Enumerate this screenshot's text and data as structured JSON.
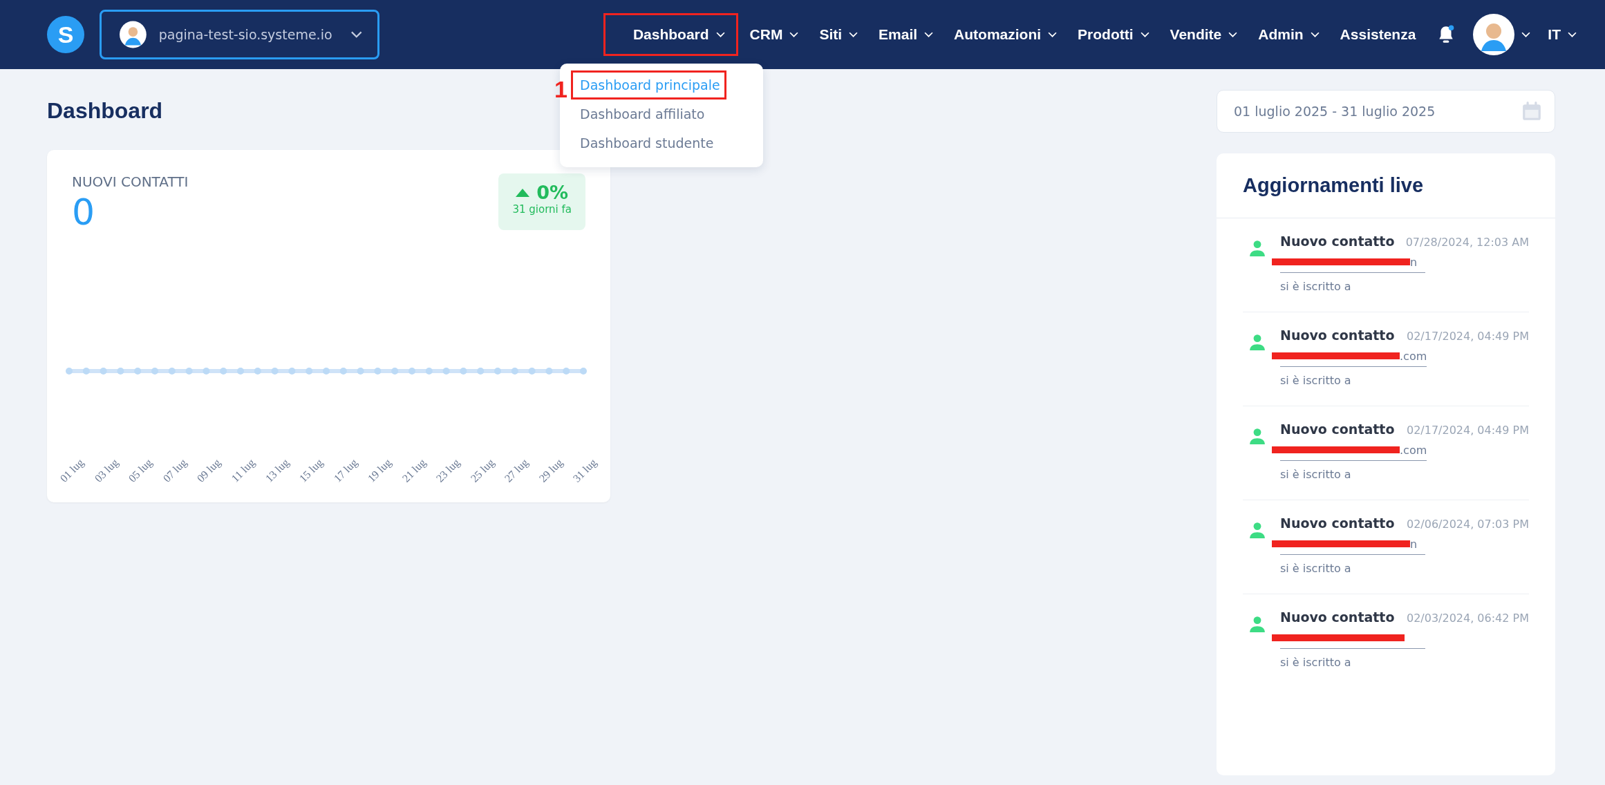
{
  "navbar": {
    "logo": "S",
    "site_selector": {
      "value": "pagina-test-sio.systeme.io"
    },
    "menu": [
      {
        "label": "Dashboard",
        "dropdown": true,
        "selected": true,
        "highlighted": true
      },
      {
        "label": "CRM",
        "dropdown": true,
        "selected": false,
        "highlighted": false
      },
      {
        "label": "Siti",
        "dropdown": true,
        "selected": false,
        "highlighted": false
      },
      {
        "label": "Email",
        "dropdown": true,
        "selected": false,
        "highlighted": false
      },
      {
        "label": "Automazioni",
        "dropdown": true,
        "selected": false,
        "highlighted": false
      },
      {
        "label": "Prodotti",
        "dropdown": true,
        "selected": false,
        "highlighted": false
      },
      {
        "label": "Vendite",
        "dropdown": true,
        "selected": false,
        "highlighted": false
      },
      {
        "label": "Admin",
        "dropdown": true,
        "selected": false,
        "highlighted": false
      },
      {
        "label": "Assistenza",
        "dropdown": false,
        "selected": false,
        "highlighted": false
      }
    ],
    "notifications": {
      "unread": true
    },
    "language": "IT"
  },
  "dropdown_menu": {
    "step_label": "1",
    "items": [
      {
        "label": "Dashboard principale",
        "selected": true,
        "highlighted": true
      },
      {
        "label": "Dashboard affiliato",
        "selected": false,
        "highlighted": false
      },
      {
        "label": "Dashboard studente",
        "selected": false,
        "highlighted": false
      }
    ]
  },
  "page_title": "Dashboard",
  "date_range": {
    "value": "01 luglio 2025 - 31 luglio 2025"
  },
  "stat_card": {
    "title": "NUOVI CONTATTI",
    "value": "0",
    "change": "0%",
    "period": "31 giorni fa",
    "x_labels": [
      "01 lug",
      "03 lug",
      "05 lug",
      "07 lug",
      "09 lug",
      "11 lug",
      "13 lug",
      "15 lug",
      "17 lug",
      "19 lug",
      "21 lug",
      "23 lug",
      "25 lug",
      "27 lug",
      "29 lug",
      "31 lug"
    ]
  },
  "live_updates": {
    "title": "Aggiornamenti live",
    "items": [
      {
        "title": "Nuovo contatto",
        "time": "07/28/2024, 12:03 AM",
        "email_visible": "n",
        "redacted": true,
        "action": "si è iscritto a"
      },
      {
        "title": "Nuovo contatto",
        "time": "02/17/2024, 04:49 PM",
        "email_visible": ".com",
        "redacted": true,
        "action": "si è iscritto a"
      },
      {
        "title": "Nuovo contatto",
        "time": "02/17/2024, 04:49 PM",
        "email_visible": ".com",
        "redacted": true,
        "action": "si è iscritto a"
      },
      {
        "title": "Nuovo contatto",
        "time": "02/06/2024, 07:03 PM",
        "email_visible": "n",
        "redacted": true,
        "action": "si è iscritto a"
      },
      {
        "title": "Nuovo contatto",
        "time": "02/03/2024, 06:42 PM",
        "redacted": true,
        "action": "si è iscritto a"
      }
    ]
  }
}
